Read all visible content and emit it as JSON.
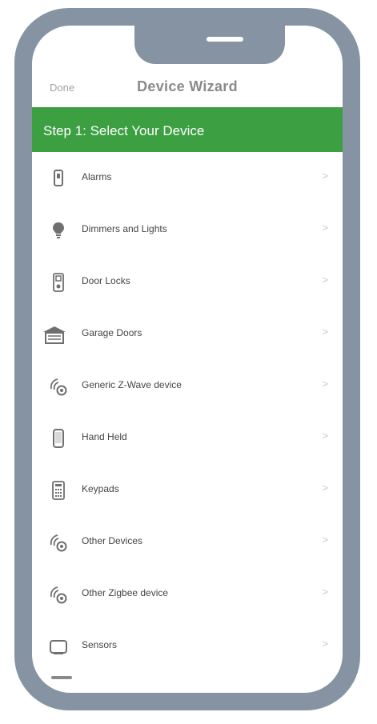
{
  "nav": {
    "done_label": "Done",
    "title": "Device Wizard"
  },
  "step": {
    "label": "Step 1: Select Your Device"
  },
  "colors": {
    "accent": "#3ca043",
    "frame": "#8593a3",
    "icon": "#7a7a7a"
  },
  "devices": [
    {
      "label": "Alarms",
      "icon": "alarm-icon"
    },
    {
      "label": "Dimmers and Lights",
      "icon": "light-bulb-icon"
    },
    {
      "label": "Door Locks",
      "icon": "door-lock-icon"
    },
    {
      "label": "Garage Doors",
      "icon": "garage-icon"
    },
    {
      "label": "Generic Z-Wave device",
      "icon": "zwave-icon"
    },
    {
      "label": "Hand Held",
      "icon": "handheld-icon"
    },
    {
      "label": "Keypads",
      "icon": "keypad-icon"
    },
    {
      "label": "Other Devices",
      "icon": "signal-icon"
    },
    {
      "label": "Other Zigbee device",
      "icon": "zigbee-icon"
    },
    {
      "label": "Sensors",
      "icon": "sensor-icon"
    }
  ],
  "chevron": ">"
}
